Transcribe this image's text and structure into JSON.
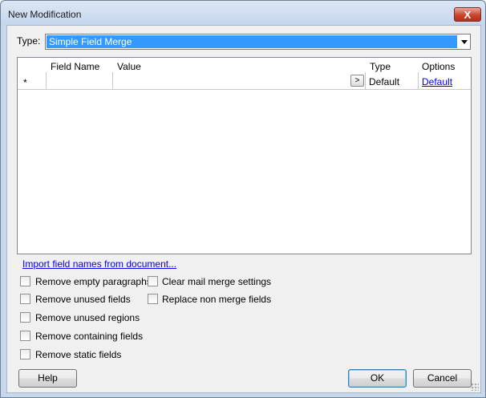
{
  "window": {
    "title": "New Modification",
    "close_glyph": "X"
  },
  "type": {
    "label": "Type:",
    "value": "Simple Field Merge"
  },
  "grid": {
    "columns": [
      "Field Name",
      "Value",
      "Type",
      "Options"
    ],
    "new_row": {
      "marker": "*",
      "field_name": "",
      "value": "",
      "value_button": ">",
      "type": "Default",
      "options": "Default"
    }
  },
  "import_link": "Import field names from document...",
  "checkboxes": {
    "remove_empty_paragraphs": {
      "label": "Remove empty paragraphs",
      "checked": false
    },
    "remove_unused_fields": {
      "label": "Remove unused fields",
      "checked": false
    },
    "remove_unused_regions": {
      "label": "Remove unused regions",
      "checked": false
    },
    "remove_containing_fields": {
      "label": "Remove containing fields",
      "checked": false
    },
    "remove_static_fields": {
      "label": "Remove static fields",
      "checked": false
    },
    "clear_mail_merge_settings": {
      "label": "Clear mail merge settings",
      "checked": false
    },
    "replace_non_merge_fields": {
      "label": "Replace non merge fields",
      "checked": false
    }
  },
  "buttons": {
    "help": "Help",
    "ok": "OK",
    "cancel": "Cancel"
  }
}
